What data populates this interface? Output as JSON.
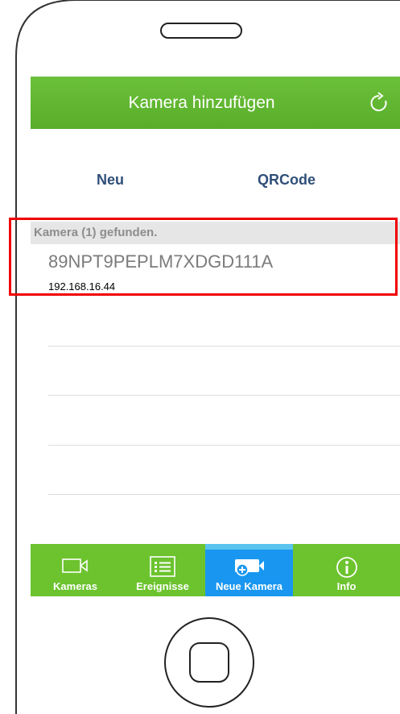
{
  "header": {
    "title": "Kamera hinzufügen"
  },
  "segments": {
    "neu": "Neu",
    "qrcode": "QRCode"
  },
  "section": {
    "title": "Kamera (1) gefunden."
  },
  "camera": {
    "id": "89NPT9PEPLM7XDGD111A",
    "ip": "192.168.16.44"
  },
  "tabs": {
    "kameras": "Kameras",
    "ereignisse": "Ereignisse",
    "neue_kamera": "Neue Kamera",
    "info": "Info"
  },
  "colors": {
    "header_green": "#5cb12e",
    "tab_active_blue": "#1997f0",
    "highlight_red": "#f00000"
  }
}
